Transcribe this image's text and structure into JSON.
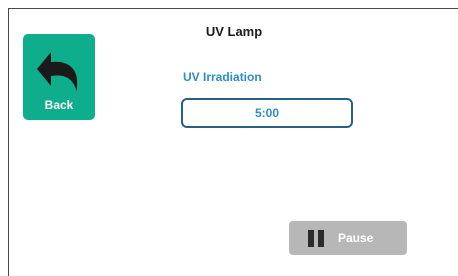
{
  "header": {
    "title": "UV Lamp"
  },
  "back": {
    "label": "Back",
    "icon": "undo-arrow-icon",
    "color": "#0eae8c"
  },
  "irradiation": {
    "label": "UV Irradiation",
    "value": "5:00",
    "label_color": "#2e8ec9",
    "border_color": "#2a5f86"
  },
  "pause": {
    "label": "Pause",
    "icon": "pause-icon",
    "color": "#b7b7b7"
  }
}
